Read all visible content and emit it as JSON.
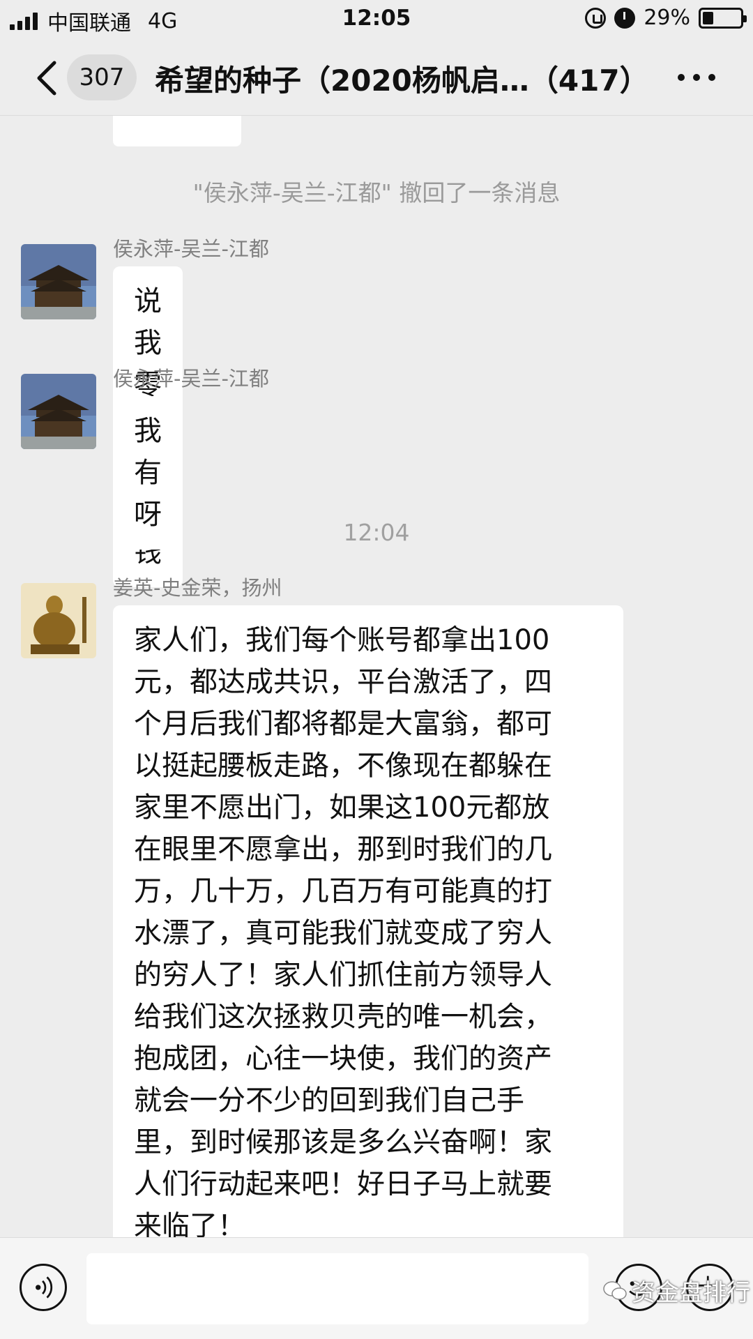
{
  "status_bar": {
    "carrier": "中国联通",
    "network": "4G",
    "time": "12:05",
    "battery_percent": "29%",
    "battery_level": 0.29,
    "icons": [
      "signal-icon",
      "rotation-lock-icon",
      "alarm-icon",
      "battery-icon"
    ]
  },
  "nav": {
    "unread_count": "307",
    "title": "希望的种子（2020杨帆启…（417）",
    "icons": [
      "back-icon",
      "more-icon"
    ]
  },
  "chat": {
    "recall_notice": "\"侯永萍-吴兰-江都\" 撤回了一条消息",
    "time_divider": "12:04",
    "messages": [
      {
        "sender": "侯永萍-吴兰-江都",
        "text": "说我零钱包没钱"
      },
      {
        "sender": "侯永萍-吴兰-江都",
        "text": "我有呀"
      },
      {
        "sender": "姜英-史金荣，扬州",
        "lines": [
          "家人们，我们每个账号都拿出100",
          "元，都达成共识，平台激活了，四",
          "个月后我们都将都是大富翁，都可",
          "以挺起腰板走路，不像现在都躲在",
          "家里不愿出门，如果这100元都放",
          "在眼里不愿拿出，那到时我们的几",
          "万，几十万，几百万有可能真的打",
          "水漂了，真可能我们就变成了穷人",
          "的穷人了！家人们抓住前方领导人",
          "给我们这次拯救贝壳的唯一机会，",
          "抱成团，心往一块使，我们的资产",
          "就会一分不少的回到我们自己手",
          "里，到时候那该是多么兴奋啊！家",
          "人们行动起来吧！好日子马上就要",
          "来临了！"
        ]
      }
    ]
  },
  "input_bar": {
    "icons": [
      "voice-icon",
      "emoji-icon",
      "plus-icon"
    ]
  },
  "watermark": {
    "text": "资金盘排行"
  }
}
